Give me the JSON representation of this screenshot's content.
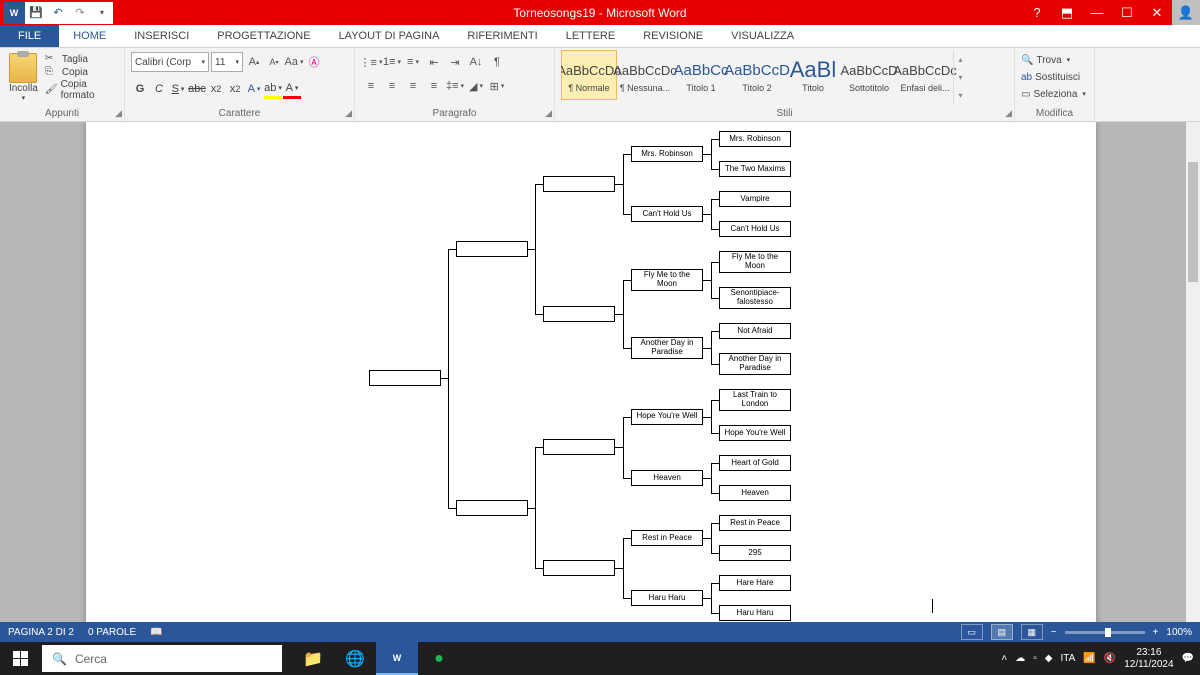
{
  "title": "Torneosongs19 - Microsoft Word",
  "tabs": {
    "file": "FILE",
    "home": "HOME",
    "insert": "INSERISCI",
    "design": "PROGETTAZIONE",
    "layout": "LAYOUT DI PAGINA",
    "refs": "RIFERIMENTI",
    "letters": "LETTERE",
    "review": "REVISIONE",
    "view": "VISUALIZZA"
  },
  "clipboard": {
    "paste": "Incolla",
    "cut": "Taglia",
    "copy": "Copia",
    "format": "Copia formato",
    "label": "Appunti"
  },
  "font": {
    "name": "Calibri (Corp",
    "size": "11",
    "label": "Carattere"
  },
  "paragraph": {
    "label": "Paragrafo"
  },
  "styles": {
    "label": "Stili",
    "items": [
      {
        "preview": "AaBbCcDc",
        "name": "¶ Normale"
      },
      {
        "preview": "AaBbCcDc",
        "name": "¶ Nessuna..."
      },
      {
        "preview": "AaBbCc",
        "name": "Titolo 1"
      },
      {
        "preview": "AaBbCcD",
        "name": "Titolo 2"
      },
      {
        "preview": "AaBl",
        "name": "Titolo"
      },
      {
        "preview": "AaBbCcD",
        "name": "Sottotitolo"
      },
      {
        "preview": "AaBbCcDc",
        "name": "Enfasi deli..."
      }
    ]
  },
  "edit": {
    "find": "Trova",
    "replace": "Sostituisci",
    "select": "Seleziona",
    "label": "Modifica"
  },
  "bracket": {
    "r16": [
      "Mrs. Robinson",
      "The Two Maxims",
      "Vampire",
      "Can't Hold Us",
      "Fly Me to the Moon",
      "Senontipiace-falostesso",
      "Not Afraid",
      "Another Day in Paradise",
      "Last Train to London",
      "Hope You're Well",
      "Heart of Gold",
      "Heaven",
      "Rest in Peace",
      "295",
      "Hare Hare",
      "Haru Haru"
    ],
    "r8": [
      "Mrs. Robinson",
      "Can't Hold Us",
      "Fly Me to the Moon",
      "Another Day in Paradise",
      "Hope You're Well",
      "Heaven",
      "Rest in Peace",
      "Haru Haru"
    ]
  },
  "status": {
    "page": "PAGINA 2 DI 2",
    "words": "0 PAROLE",
    "zoom": "100%"
  },
  "taskbar": {
    "search": "Cerca",
    "time": "23:16",
    "date": "12/11/2024"
  }
}
